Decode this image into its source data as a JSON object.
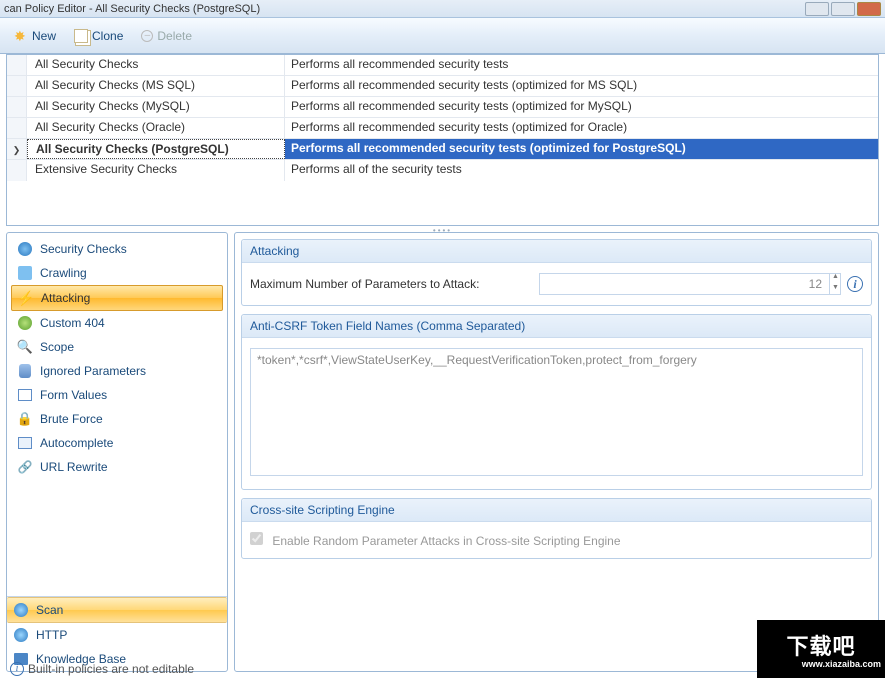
{
  "window": {
    "title": "can Policy Editor - All Security Checks (PostgreSQL)"
  },
  "toolbar": {
    "new_label": "New",
    "clone_label": "Clone",
    "delete_label": "Delete"
  },
  "policies": [
    {
      "name": "All Security Checks",
      "desc": "Performs all recommended security tests",
      "selected": false
    },
    {
      "name": "All Security Checks (MS SQL)",
      "desc": "Performs all recommended security tests (optimized for MS SQL)",
      "selected": false
    },
    {
      "name": "All Security Checks (MySQL)",
      "desc": "Performs all recommended security tests (optimized for MySQL)",
      "selected": false
    },
    {
      "name": "All Security Checks (Oracle)",
      "desc": "Performs all recommended security tests (optimized for Oracle)",
      "selected": false
    },
    {
      "name": "All Security Checks (PostgreSQL)",
      "desc": "Performs all recommended security tests (optimized for PostgreSQL)",
      "selected": true
    },
    {
      "name": "Extensive Security Checks",
      "desc": "Performs all of the security tests",
      "selected": false
    }
  ],
  "sidebar": {
    "items": [
      {
        "label": "Security Checks",
        "icon": "globe-icon"
      },
      {
        "label": "Crawling",
        "icon": "network-icon"
      },
      {
        "label": "Attacking",
        "icon": "bolt-icon",
        "selected": true
      },
      {
        "label": "Custom 404",
        "icon": "404-icon"
      },
      {
        "label": "Scope",
        "icon": "scope-icon"
      },
      {
        "label": "Ignored Parameters",
        "icon": "db-icon"
      },
      {
        "label": "Form Values",
        "icon": "form-icon"
      },
      {
        "label": "Brute Force",
        "icon": "lock-icon"
      },
      {
        "label": "Autocomplete",
        "icon": "auto-icon"
      },
      {
        "label": "URL Rewrite",
        "icon": "link-icon"
      }
    ],
    "bottom": [
      {
        "label": "Scan",
        "icon": "scan-icon",
        "primary": true
      },
      {
        "label": "HTTP",
        "icon": "http-icon"
      },
      {
        "label": "Knowledge Base",
        "icon": "book-icon"
      }
    ]
  },
  "panels": {
    "attacking": {
      "header": "Attacking",
      "max_params_label": "Maximum Number of Parameters to Attack:",
      "max_params_value": "12"
    },
    "anticsrf": {
      "header": "Anti-CSRF Token Field Names (Comma Separated)",
      "value": "*token*,*csrf*,ViewStateUserKey,__RequestVerificationToken,protect_from_forgery"
    },
    "xss": {
      "header": "Cross-site Scripting Engine",
      "checkbox_label": "Enable Random Parameter Attacks in Cross-site Scripting Engine",
      "checked": true,
      "disabled": true
    }
  },
  "footer": {
    "note": "Built-in policies are not editable"
  },
  "watermark": {
    "cn": "下载吧",
    "url": "www.xiazaiba.com"
  }
}
